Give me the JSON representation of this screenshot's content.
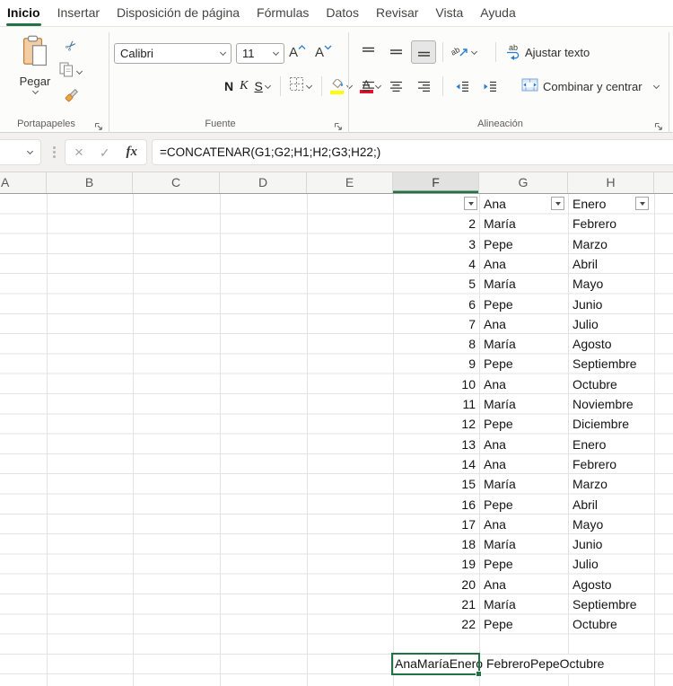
{
  "ribbon_tabs": [
    {
      "label": "Inicio",
      "active": true
    },
    {
      "label": "Insertar",
      "active": false
    },
    {
      "label": "Disposición de página",
      "active": false
    },
    {
      "label": "Fórmulas",
      "active": false
    },
    {
      "label": "Datos",
      "active": false
    },
    {
      "label": "Revisar",
      "active": false
    },
    {
      "label": "Vista",
      "active": false
    },
    {
      "label": "Ayuda",
      "active": false
    }
  ],
  "ribbon": {
    "clipboard": {
      "group_label": "Portapapeles",
      "paste_label": "Pegar"
    },
    "font": {
      "group_label": "Fuente",
      "font_name": "Calibri",
      "font_size": "11",
      "bold_label": "N",
      "italic_label": "K",
      "underline_label": "S",
      "font_color_letter": "A"
    },
    "alignment": {
      "group_label": "Alineación",
      "wrap_text_label": "Ajustar texto",
      "merge_center_label": "Combinar y centrar"
    }
  },
  "formula_bar": {
    "formula": "=CONCATENAR(G1;G2;H1;H2;G3;H22;)",
    "fx_label": "fx",
    "cancel_glyph": "×",
    "enter_glyph": "✓"
  },
  "grid": {
    "column_headers": [
      "A",
      "B",
      "C",
      "D",
      "E",
      "F",
      "G",
      "H",
      ""
    ],
    "selected_column": "F",
    "filter_row": {
      "f": "",
      "g": "Ana",
      "h": "Enero"
    },
    "rows": [
      [
        2,
        "María",
        "Febrero"
      ],
      [
        3,
        "Pepe",
        "Marzo"
      ],
      [
        4,
        "Ana",
        "Abril"
      ],
      [
        5,
        "María",
        "Mayo"
      ],
      [
        6,
        "Pepe",
        "Junio"
      ],
      [
        7,
        "Ana",
        "Julio"
      ],
      [
        8,
        "María",
        "Agosto"
      ],
      [
        9,
        "Pepe",
        "Septiembre"
      ],
      [
        10,
        "Ana",
        "Octubre"
      ],
      [
        11,
        "María",
        "Noviembre"
      ],
      [
        12,
        "Pepe",
        "Diciembre"
      ],
      [
        13,
        "Ana",
        "Enero"
      ],
      [
        14,
        "Ana",
        "Febrero"
      ],
      [
        15,
        "María",
        "Marzo"
      ],
      [
        16,
        "Pepe",
        "Abril"
      ],
      [
        17,
        "Ana",
        "Mayo"
      ],
      [
        18,
        "María",
        "Junio"
      ],
      [
        19,
        "Pepe",
        "Julio"
      ],
      [
        20,
        "Ana",
        "Agosto"
      ],
      [
        21,
        "María",
        "Septiembre"
      ],
      [
        22,
        "Pepe",
        "Octubre"
      ]
    ],
    "result_cell": {
      "text": "AnaMaríaEnero FebreroPepeOctubre",
      "row": 24,
      "column": "F"
    }
  },
  "colors": {
    "accent_green": "#217346",
    "highlight_yellow": "#ffff00",
    "font_color_red": "#e8112d"
  }
}
